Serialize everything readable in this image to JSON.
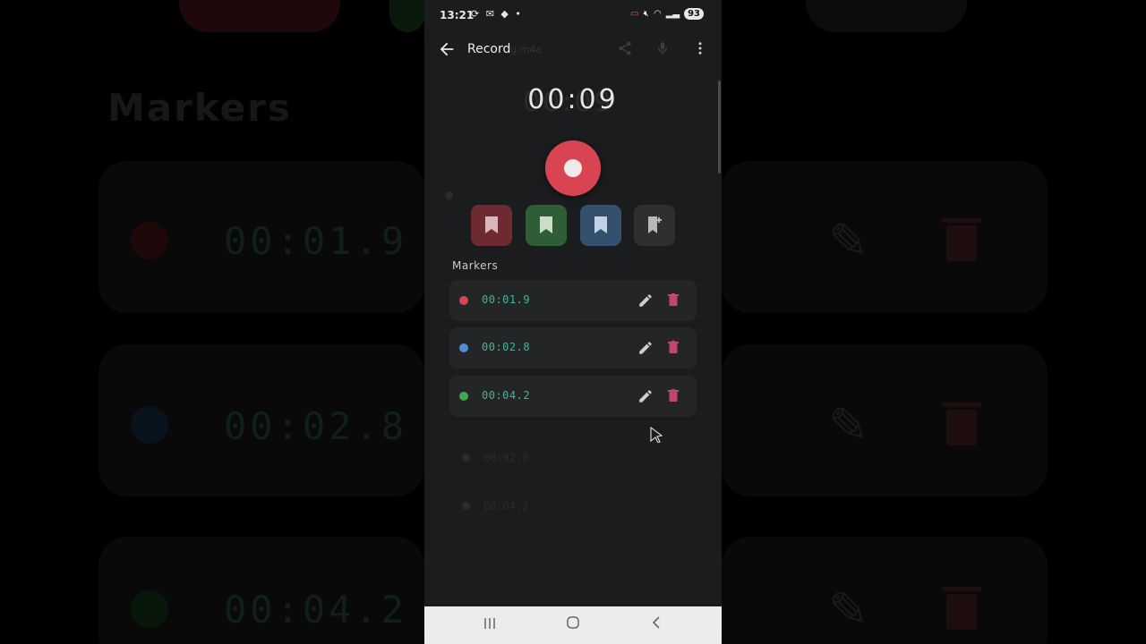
{
  "status": {
    "time": "13:21",
    "notifications": "⟳ ✉ ◆ •",
    "battery": "93"
  },
  "appbar": {
    "title": "Record",
    "ghost_filename": "g.m4a"
  },
  "timer": {
    "value": "00:09"
  },
  "markers_section": {
    "label": "Markers"
  },
  "marker_buttons": [
    {
      "color": "#6e2a31",
      "label": "red-marker"
    },
    {
      "color": "#2f5e36",
      "label": "green-marker"
    },
    {
      "color": "#33506c",
      "label": "blue-marker"
    },
    {
      "color": "#2d2f31",
      "label": "custom-marker"
    }
  ],
  "markers": [
    {
      "time": "00:01.9",
      "color": "#d94452"
    },
    {
      "time": "00:02.8",
      "color": "#4f8fd1"
    },
    {
      "time": "00:04.2",
      "color": "#3fa84a"
    }
  ],
  "background": {
    "title": "Markers",
    "times": [
      "00:01.9",
      "00:02.8",
      "00:04.2"
    ]
  },
  "colors": {
    "accent_record": "#d94452",
    "time_text": "#3fb596",
    "delete": "#c2456a"
  }
}
